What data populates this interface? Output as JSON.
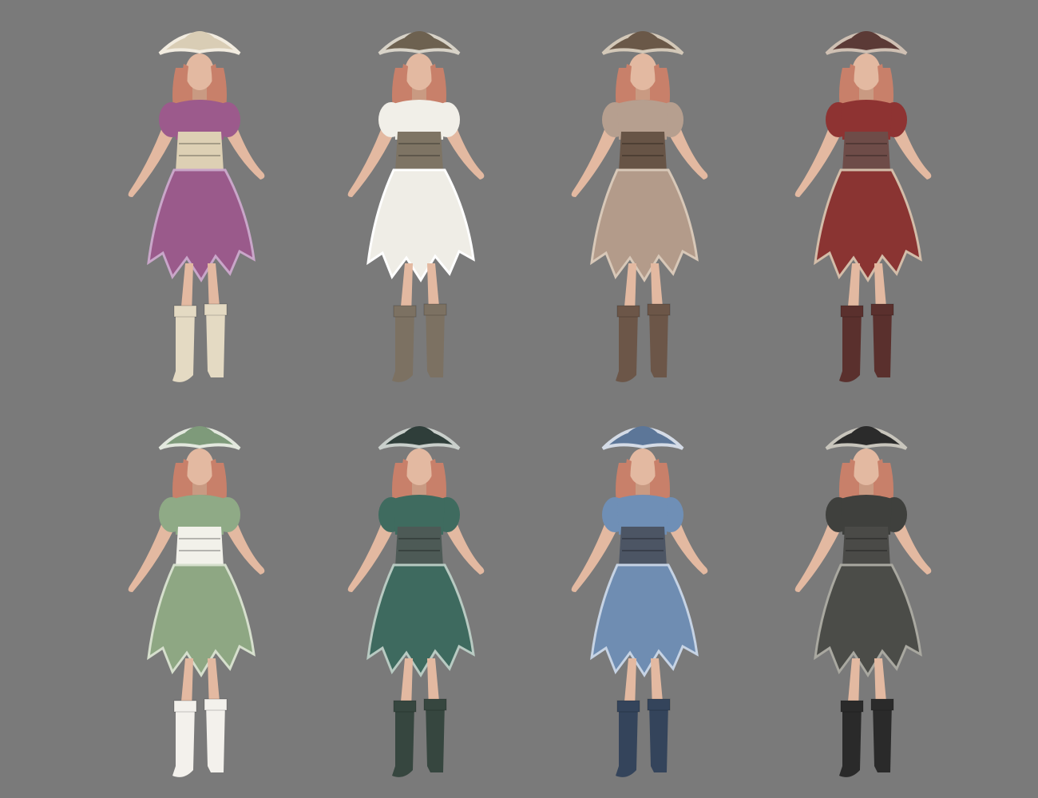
{
  "background": "#7a7a7a",
  "skin": "#e3b9a1",
  "skin_shade": "#c99a82",
  "hair": "#c8806a",
  "variants": [
    {
      "hat": "#d9cdb5",
      "hat_trim": "#f2ece0",
      "blouse": "#9c5a8c",
      "corset": "#ddd0b4",
      "skirt": "#9a5a8b",
      "skirt_trim": "#c9a6c9",
      "boots": "#e4dac3"
    },
    {
      "hat": "#6d6150",
      "hat_trim": "#d8d3c8",
      "blouse": "#f1efe8",
      "corset": "#7e7464",
      "skirt": "#efede6",
      "skirt_trim": "#ffffff",
      "boots": "#7c7162"
    },
    {
      "hat": "#6a5848",
      "hat_trim": "#d3c8b8",
      "blouse": "#b69f8f",
      "corset": "#675446",
      "skirt": "#b39b8a",
      "skirt_trim": "#d8c8b8",
      "boots": "#6c5648"
    },
    {
      "hat": "#5b3a36",
      "hat_trim": "#cfc0b3",
      "blouse": "#8e3332",
      "corset": "#6e4c48",
      "skirt": "#8a3432",
      "skirt_trim": "#d3bda9",
      "boots": "#5a302d"
    },
    {
      "hat": "#7e9a7a",
      "hat_trim": "#e3e8de",
      "blouse": "#8faa86",
      "corset": "#f2f1ea",
      "skirt": "#8ea783",
      "skirt_trim": "#d6dfcd",
      "boots": "#f3f1ec"
    },
    {
      "hat": "#2f3e3a",
      "hat_trim": "#c9cfcb",
      "blouse": "#3f6b5f",
      "corset": "#4d5a56",
      "skirt": "#3e6a5f",
      "skirt_trim": "#b8cac2",
      "boots": "#36463f"
    },
    {
      "hat": "#5c7698",
      "hat_trim": "#d4dbe6",
      "blouse": "#6f8fb6",
      "corset": "#4c5564",
      "skirt": "#6f8db2",
      "skirt_trim": "#c6d3e4",
      "boots": "#34445b"
    },
    {
      "hat": "#2b2b2b",
      "hat_trim": "#c8c5bc",
      "blouse": "#3f403d",
      "corset": "#4a4a47",
      "skirt": "#4b4c48",
      "skirt_trim": "#a9a8a0",
      "boots": "#2a2a2a"
    }
  ]
}
